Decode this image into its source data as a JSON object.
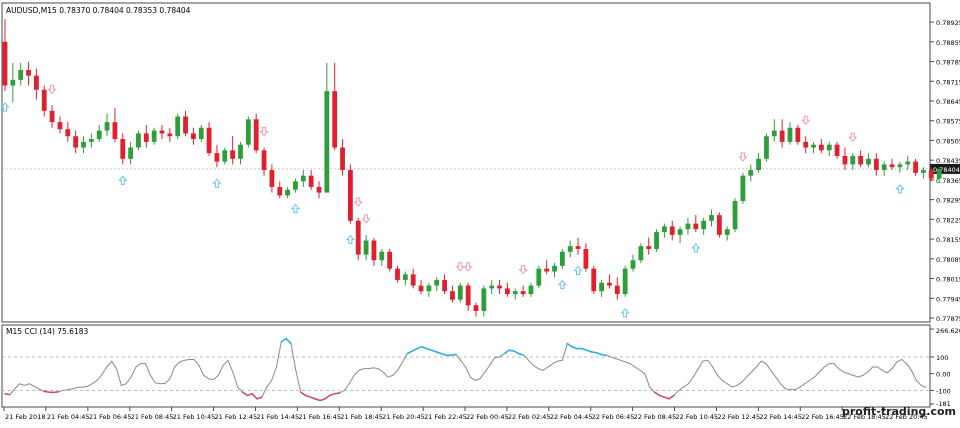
{
  "main_header": "AUDUSD,M15  0.78370 0.78404 0.78353 0.78404",
  "cci_header": "M15 CCI (14) 75.6183",
  "watermark": "profit-trading.com",
  "colors": {
    "bull": "#2e9e3a",
    "bear": "#e0202e",
    "arrow_up": "#66c6ee",
    "arrow_down": "#f09ab2",
    "cci_line": "#8a8a8a",
    "cci_over": "#28b2e6",
    "cci_under": "#c8507a",
    "price_tag_bg": "#1a1a1a",
    "price_tag_text": "#ffffff"
  },
  "chart_data": [
    {
      "type": "candlestick",
      "panel": "price",
      "ylim": [
        0.77875,
        0.78975
      ],
      "y_ticks": [
        "0.78925",
        "0.78855",
        "0.78785",
        "0.78715",
        "0.78645",
        "0.78575",
        "0.78505",
        "0.78435",
        "0.78365",
        "0.78295",
        "0.78225",
        "0.78155",
        "0.78085",
        "0.78015",
        "0.77945",
        "0.77875"
      ],
      "current_price": "0.78404",
      "candles": [
        [
          0.78855,
          0.78935,
          0.7868,
          0.787
        ],
        [
          0.787,
          0.7878,
          0.7864,
          0.7872
        ],
        [
          0.7872,
          0.7878,
          0.787,
          0.78755
        ],
        [
          0.78755,
          0.78785,
          0.787,
          0.78735
        ],
        [
          0.78735,
          0.7876,
          0.7865,
          0.78685
        ],
        [
          0.78685,
          0.787,
          0.7859,
          0.7861
        ],
        [
          0.7861,
          0.7863,
          0.7855,
          0.7857
        ],
        [
          0.7857,
          0.7859,
          0.7853,
          0.78545
        ],
        [
          0.78545,
          0.7857,
          0.785,
          0.7852
        ],
        [
          0.7852,
          0.7854,
          0.7846,
          0.7848
        ],
        [
          0.7848,
          0.7852,
          0.7846,
          0.785
        ],
        [
          0.785,
          0.7853,
          0.7848,
          0.7851
        ],
        [
          0.7851,
          0.7856,
          0.785,
          0.7854
        ],
        [
          0.7854,
          0.786,
          0.7852,
          0.7857
        ],
        [
          0.7857,
          0.7862,
          0.785,
          0.7851
        ],
        [
          0.7851,
          0.7853,
          0.7842,
          0.7844
        ],
        [
          0.7844,
          0.785,
          0.7842,
          0.7848
        ],
        [
          0.7848,
          0.7854,
          0.7847,
          0.7853
        ],
        [
          0.7853,
          0.7856,
          0.7848,
          0.785
        ],
        [
          0.785,
          0.7855,
          0.7849,
          0.7854
        ],
        [
          0.7854,
          0.7856,
          0.7851,
          0.7853
        ],
        [
          0.7853,
          0.7855,
          0.785,
          0.7852
        ],
        [
          0.7852,
          0.786,
          0.7851,
          0.7859
        ],
        [
          0.7859,
          0.7861,
          0.7852,
          0.7853
        ],
        [
          0.7853,
          0.7855,
          0.7849,
          0.7851
        ],
        [
          0.7851,
          0.7856,
          0.785,
          0.7855
        ],
        [
          0.7855,
          0.7857,
          0.7845,
          0.7846
        ],
        [
          0.7846,
          0.7849,
          0.7841,
          0.7843
        ],
        [
          0.7843,
          0.7848,
          0.7842,
          0.7847
        ],
        [
          0.7847,
          0.7852,
          0.7842,
          0.7844
        ],
        [
          0.7844,
          0.785,
          0.7842,
          0.7849
        ],
        [
          0.7849,
          0.7859,
          0.7848,
          0.7858
        ],
        [
          0.7858,
          0.786,
          0.7846,
          0.7847
        ],
        [
          0.7847,
          0.7848,
          0.7838,
          0.784
        ],
        [
          0.784,
          0.7842,
          0.7832,
          0.7834
        ],
        [
          0.7834,
          0.7836,
          0.783,
          0.7831
        ],
        [
          0.7831,
          0.7834,
          0.783,
          0.7833
        ],
        [
          0.7833,
          0.7837,
          0.7832,
          0.7836
        ],
        [
          0.7836,
          0.784,
          0.7834,
          0.7838
        ],
        [
          0.7838,
          0.784,
          0.7833,
          0.7834
        ],
        [
          0.7834,
          0.7836,
          0.783,
          0.7832
        ],
        [
          0.7832,
          0.7878,
          0.7832,
          0.7868
        ],
        [
          0.7868,
          0.7878,
          0.7847,
          0.7848
        ],
        [
          0.7848,
          0.7851,
          0.7838,
          0.784
        ],
        [
          0.784,
          0.7842,
          0.7821,
          0.7822
        ],
        [
          0.7822,
          0.7823,
          0.7808,
          0.781
        ],
        [
          0.781,
          0.7817,
          0.7808,
          0.7815
        ],
        [
          0.7815,
          0.7816,
          0.7806,
          0.7808
        ],
        [
          0.7808,
          0.7812,
          0.7806,
          0.7811
        ],
        [
          0.7811,
          0.7812,
          0.7804,
          0.7805
        ],
        [
          0.7805,
          0.7806,
          0.78,
          0.7801
        ],
        [
          0.7801,
          0.7804,
          0.7799,
          0.7803
        ],
        [
          0.7803,
          0.7805,
          0.7798,
          0.7799
        ],
        [
          0.7799,
          0.7801,
          0.7796,
          0.7797
        ],
        [
          0.7797,
          0.78,
          0.7795,
          0.7799
        ],
        [
          0.7799,
          0.7802,
          0.7797,
          0.7801
        ],
        [
          0.7801,
          0.7803,
          0.7796,
          0.7797
        ],
        [
          0.7797,
          0.7799,
          0.7793,
          0.7794
        ],
        [
          0.7794,
          0.78,
          0.7793,
          0.7799
        ],
        [
          0.7799,
          0.78,
          0.779,
          0.7792
        ],
        [
          0.7792,
          0.7793,
          0.7788,
          0.779
        ],
        [
          0.779,
          0.7799,
          0.7788,
          0.7798
        ],
        [
          0.7798,
          0.7801,
          0.7796,
          0.7799
        ],
        [
          0.7799,
          0.7801,
          0.7796,
          0.7798
        ],
        [
          0.7798,
          0.78,
          0.7795,
          0.7796
        ],
        [
          0.7796,
          0.7798,
          0.7794,
          0.7797
        ],
        [
          0.7797,
          0.7799,
          0.7795,
          0.7796
        ],
        [
          0.7796,
          0.78,
          0.7795,
          0.7799
        ],
        [
          0.7799,
          0.7806,
          0.7798,
          0.7805
        ],
        [
          0.7805,
          0.7808,
          0.7803,
          0.7804
        ],
        [
          0.7804,
          0.7807,
          0.7802,
          0.7806
        ],
        [
          0.7806,
          0.7812,
          0.7805,
          0.7811
        ],
        [
          0.7811,
          0.7815,
          0.7809,
          0.7813
        ],
        [
          0.7813,
          0.7816,
          0.781,
          0.7812
        ],
        [
          0.7812,
          0.7814,
          0.7804,
          0.7805
        ],
        [
          0.7805,
          0.7806,
          0.7796,
          0.7797
        ],
        [
          0.7797,
          0.7801,
          0.7795,
          0.78
        ],
        [
          0.78,
          0.7803,
          0.7798,
          0.7799
        ],
        [
          0.7799,
          0.7802,
          0.7794,
          0.7796
        ],
        [
          0.7796,
          0.7806,
          0.7795,
          0.7805
        ],
        [
          0.7805,
          0.781,
          0.7804,
          0.7808
        ],
        [
          0.7808,
          0.7814,
          0.7807,
          0.7813
        ],
        [
          0.7813,
          0.7816,
          0.781,
          0.7812
        ],
        [
          0.7812,
          0.7819,
          0.7811,
          0.7818
        ],
        [
          0.7818,
          0.7821,
          0.7816,
          0.782
        ],
        [
          0.782,
          0.7822,
          0.7815,
          0.7817
        ],
        [
          0.7817,
          0.782,
          0.7814,
          0.7819
        ],
        [
          0.7819,
          0.7823,
          0.7817,
          0.7821
        ],
        [
          0.7821,
          0.7824,
          0.7818,
          0.7819
        ],
        [
          0.7819,
          0.7823,
          0.7817,
          0.7822
        ],
        [
          0.7822,
          0.7826,
          0.782,
          0.7824
        ],
        [
          0.7824,
          0.7825,
          0.7816,
          0.7817
        ],
        [
          0.7817,
          0.782,
          0.7815,
          0.7819
        ],
        [
          0.7819,
          0.783,
          0.7818,
          0.7829
        ],
        [
          0.7829,
          0.7839,
          0.7828,
          0.7838
        ],
        [
          0.7838,
          0.7842,
          0.7836,
          0.784
        ],
        [
          0.784,
          0.7846,
          0.7839,
          0.7844
        ],
        [
          0.7844,
          0.7853,
          0.7843,
          0.7852
        ],
        [
          0.7852,
          0.7858,
          0.785,
          0.7854
        ],
        [
          0.7854,
          0.7858,
          0.7848,
          0.785
        ],
        [
          0.785,
          0.7857,
          0.7849,
          0.7855
        ],
        [
          0.7855,
          0.7856,
          0.7849,
          0.785
        ],
        [
          0.785,
          0.7852,
          0.7846,
          0.7848
        ],
        [
          0.7848,
          0.785,
          0.7846,
          0.7849
        ],
        [
          0.7849,
          0.7851,
          0.7846,
          0.7847
        ],
        [
          0.7847,
          0.785,
          0.7845,
          0.7849
        ],
        [
          0.7849,
          0.785,
          0.7844,
          0.7845
        ],
        [
          0.7845,
          0.7848,
          0.784,
          0.7842
        ],
        [
          0.7842,
          0.7846,
          0.784,
          0.7845
        ],
        [
          0.7845,
          0.7847,
          0.7841,
          0.7842
        ],
        [
          0.7842,
          0.7846,
          0.7841,
          0.7844
        ],
        [
          0.7844,
          0.7846,
          0.7838,
          0.784
        ],
        [
          0.784,
          0.7843,
          0.7838,
          0.7842
        ],
        [
          0.7842,
          0.7844,
          0.784,
          0.7841
        ],
        [
          0.7841,
          0.7843,
          0.7839,
          0.7842
        ],
        [
          0.7842,
          0.7845,
          0.784,
          0.7843
        ],
        [
          0.7843,
          0.7844,
          0.7838,
          0.7839
        ],
        [
          0.7839,
          0.7841,
          0.7837,
          0.784
        ],
        [
          0.784,
          0.7841,
          0.7836,
          0.7837
        ],
        [
          0.7837,
          0.7841,
          0.78353,
          0.78404
        ]
      ],
      "signals": [
        {
          "i": 0,
          "dir": "up"
        },
        {
          "i": 6,
          "dir": "down"
        },
        {
          "i": 15,
          "dir": "up"
        },
        {
          "i": 27,
          "dir": "up"
        },
        {
          "i": 33,
          "dir": "down"
        },
        {
          "i": 37,
          "dir": "up"
        },
        {
          "i": 44,
          "dir": "up"
        },
        {
          "i": 45,
          "dir": "down"
        },
        {
          "i": 46,
          "dir": "down"
        },
        {
          "i": 58,
          "dir": "down"
        },
        {
          "i": 59,
          "dir": "down"
        },
        {
          "i": 66,
          "dir": "down"
        },
        {
          "i": 71,
          "dir": "up"
        },
        {
          "i": 73,
          "dir": "up"
        },
        {
          "i": 79,
          "dir": "up"
        },
        {
          "i": 88,
          "dir": "up"
        },
        {
          "i": 94,
          "dir": "down"
        },
        {
          "i": 102,
          "dir": "down"
        },
        {
          "i": 108,
          "dir": "down"
        },
        {
          "i": 114,
          "dir": "up"
        }
      ]
    },
    {
      "type": "line",
      "panel": "cci",
      "title": "M15 CCI (14) 75.6183",
      "ylim": [
        -181,
        267
      ],
      "y_tick_labels": [
        "266.6205",
        "100",
        "0.00",
        "-100",
        "-181"
      ],
      "levels": [
        100,
        -100
      ],
      "values": [
        -120,
        -125,
        -90,
        -60,
        -70,
        -60,
        -75,
        -90,
        -105,
        -110,
        -112,
        -108,
        -100,
        -95,
        -90,
        -82,
        -80,
        -76,
        -60,
        -40,
        -5,
        40,
        75,
        30,
        -70,
        -60,
        -20,
        40,
        60,
        60,
        -10,
        -55,
        -60,
        -58,
        -30,
        40,
        70,
        80,
        85,
        85,
        50,
        -10,
        -30,
        -35,
        -10,
        50,
        80,
        10,
        -80,
        -110,
        -130,
        -120,
        -150,
        -140,
        -80,
        -40,
        40,
        190,
        210,
        180,
        20,
        -110,
        -130,
        -140,
        -150,
        -160,
        -150,
        -130,
        -120,
        -115,
        -100,
        -60,
        -10,
        20,
        30,
        30,
        35,
        30,
        10,
        -20,
        -10,
        20,
        70,
        120,
        135,
        150,
        160,
        150,
        140,
        130,
        120,
        110,
        110,
        115,
        80,
        40,
        -20,
        -40,
        -30,
        10,
        50,
        95,
        100,
        120,
        140,
        135,
        120,
        110,
        80,
        50,
        30,
        20,
        40,
        60,
        75,
        80,
        180,
        160,
        150,
        150,
        140,
        130,
        125,
        115,
        110,
        100,
        90,
        80,
        70,
        60,
        40,
        20,
        0,
        -80,
        -110,
        -130,
        -140,
        -150,
        -130,
        -100,
        -80,
        -60,
        -20,
        30,
        75,
        80,
        40,
        -10,
        -40,
        -60,
        -80,
        -70,
        -50,
        -20,
        10,
        40,
        75,
        60,
        20,
        -20,
        -60,
        -90,
        -95,
        -95,
        -80,
        -60,
        -40,
        -20,
        10,
        40,
        60,
        60,
        30,
        10,
        0,
        -10,
        -20,
        -10,
        10,
        40,
        40,
        20,
        5,
        30,
        70,
        85,
        60,
        20,
        -40,
        -70,
        -80
      ]
    }
  ],
  "x_tick_labels": [
    "21 Feb 2018",
    "21 Feb 04:45",
    "21 Feb 06:45",
    "21 Feb 08:45",
    "21 Feb 10:45",
    "21 Feb 12:45",
    "21 Feb 14:45",
    "21 Feb 16:45",
    "21 Feb 18:45",
    "21 Feb 20:45",
    "21 Feb 22:45",
    "22 Feb 00:45",
    "22 Feb 02:45",
    "22 Feb 04:45",
    "22 Feb 06:45",
    "22 Feb 08:45",
    "22 Feb 10:45",
    "22 Feb 12:45",
    "22 Feb 14:45",
    "22 Feb 16:45",
    "22 Feb 18:45",
    "22 Feb 20:45"
  ]
}
